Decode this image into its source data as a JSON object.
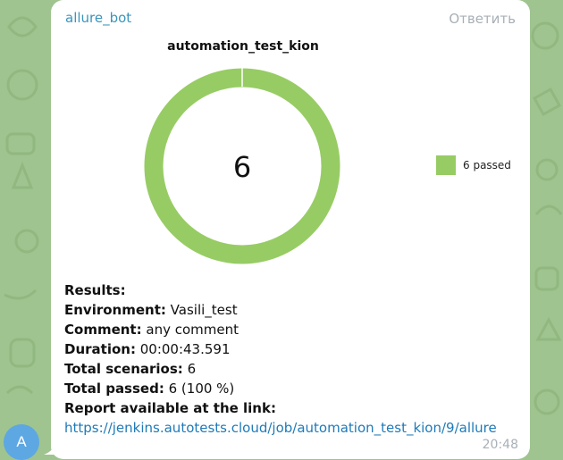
{
  "message": {
    "sender": "allure_bot",
    "reply_label": "Ответить",
    "time": "20:48",
    "avatar_letter": "A"
  },
  "chart_data": {
    "type": "pie",
    "title": "automation_test_kion",
    "center_label": "6",
    "categories": [
      "6 passed"
    ],
    "values": [
      6
    ],
    "colors": [
      "#97cc64"
    ],
    "legend": "right"
  },
  "report": {
    "results_label": "Results:",
    "environment_label": "Environment:",
    "environment_value": "Vasili_test",
    "comment_label": "Comment:",
    "comment_value": "any comment",
    "duration_label": "Duration:",
    "duration_value": "00:00:43.591",
    "total_scenarios_label": "Total scenarios:",
    "total_scenarios_value": "6",
    "total_passed_label": "Total passed:",
    "total_passed_value": "6 (100 %)",
    "report_label": "Report available at the link:",
    "report_url": "https://jenkins.autotests.cloud/job/automation_test_kion/9/allure"
  },
  "colors": {
    "chat_background": "#9fc48f",
    "bubble": "#ffffff",
    "sender": "#3a95bd",
    "link": "#1f7ab8",
    "muted": "#a8b0b6",
    "avatar": "#5da7e3",
    "passed": "#97cc64"
  }
}
